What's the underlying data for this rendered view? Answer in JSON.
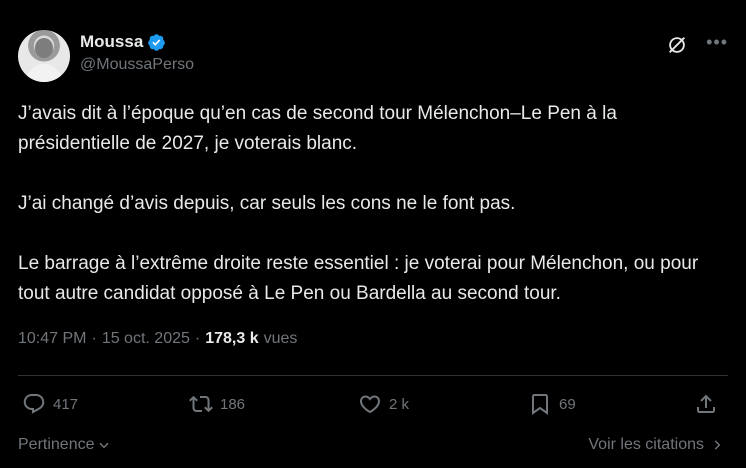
{
  "author": {
    "display_name": "Moussa",
    "handle": "@MoussaPerso",
    "verified": true
  },
  "tweet": {
    "paragraphs": [
      "J’avais dit à l’époque qu’en cas de second tour Mélenchon–Le Pen à la présidentielle de 2027, je voterais blanc.",
      "J’ai changé d’avis depuis, car seuls les cons ne le font pas.",
      "Le barrage à l’extrême droite reste essentiel : je voterai pour Mélenchon, ou pour tout autre candidat opposé à Le Pen ou Bardella au second tour."
    ]
  },
  "meta": {
    "time": "10:47 PM",
    "separator": "·",
    "date": "15 oct. 2025",
    "views_count": "178,3 k",
    "views_label": "vues"
  },
  "actions": {
    "replies": "417",
    "reposts": "186",
    "likes": "2 k",
    "bookmarks": "69"
  },
  "footer": {
    "sort_label": "Pertinence",
    "quotes_label": "Voir les citations"
  },
  "colors": {
    "background": "#000000",
    "text": "#e7e9ea",
    "muted": "#71767b",
    "verified": "#1d9bf0",
    "divider": "#2f3336"
  },
  "icons": [
    "verified-badge-icon",
    "grok-icon",
    "more-icon",
    "reply-icon",
    "repost-icon",
    "like-icon",
    "bookmark-icon",
    "share-icon",
    "chevron-down-icon",
    "chevron-right-icon"
  ]
}
